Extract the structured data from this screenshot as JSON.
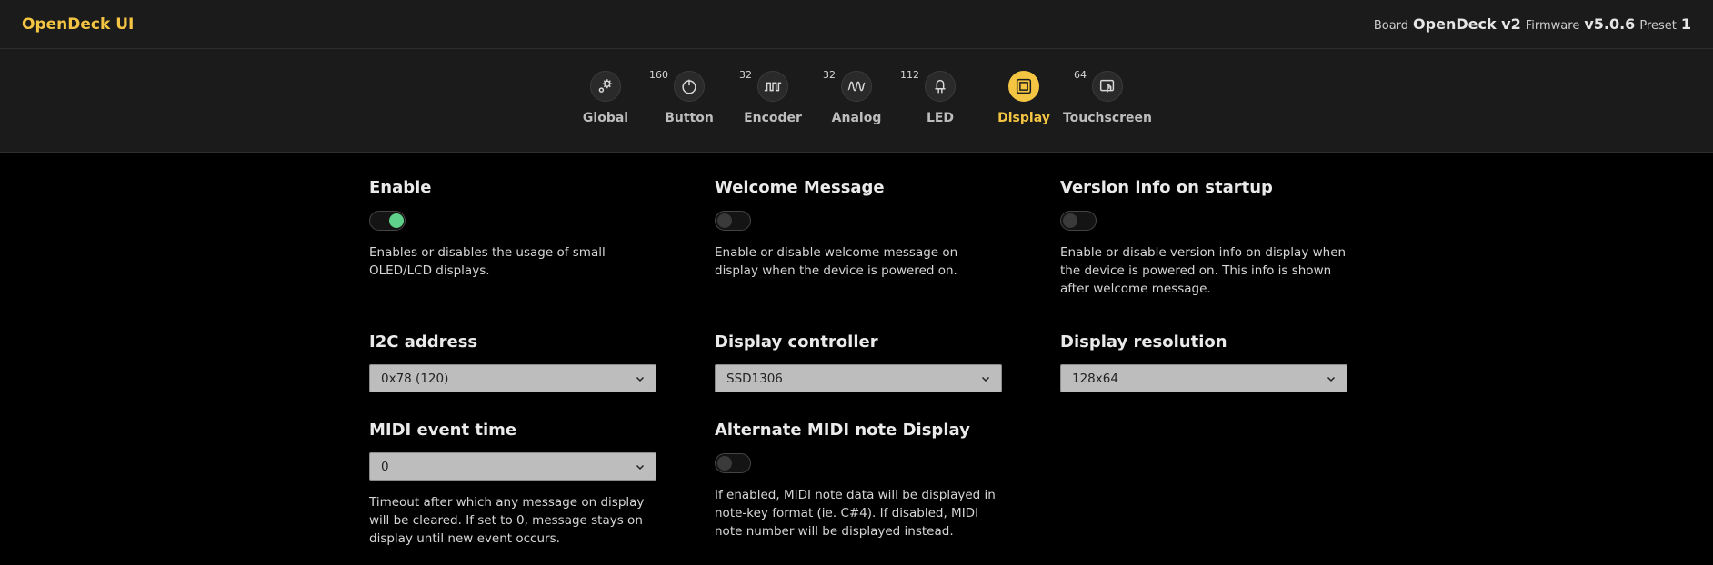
{
  "header": {
    "brand": "OpenDeck UI",
    "board_label": "Board",
    "board_value": "OpenDeck v2",
    "firmware_label": "Firmware",
    "firmware_value": "v5.0.6",
    "preset_label": "Preset",
    "preset_value": "1"
  },
  "nav": {
    "items": [
      {
        "label": "Global",
        "count": "",
        "icon": "gear-icon"
      },
      {
        "label": "Button",
        "count": "160",
        "icon": "power-button-icon"
      },
      {
        "label": "Encoder",
        "count": "32",
        "icon": "square-wave-icon"
      },
      {
        "label": "Analog",
        "count": "32",
        "icon": "sine-wave-icon"
      },
      {
        "label": "LED",
        "count": "112",
        "icon": "led-icon"
      },
      {
        "label": "Display",
        "count": "",
        "icon": "display-icon",
        "active": true
      },
      {
        "label": "Touchscreen",
        "count": "64",
        "icon": "touchscreen-icon"
      }
    ]
  },
  "settings": {
    "enable": {
      "title": "Enable",
      "on": true,
      "description": "Enables or disables the usage of small OLED/LCD displays."
    },
    "welcome": {
      "title": "Welcome Message",
      "on": false,
      "description": "Enable or disable welcome message on display when the device is powered on."
    },
    "version_info": {
      "title": "Version info on startup",
      "on": false,
      "description": "Enable or disable version info on display when the device is powered on. This info is shown after welcome message."
    },
    "i2c": {
      "title": "I2C address",
      "value": "0x78 (120)"
    },
    "controller": {
      "title": "Display controller",
      "value": "SSD1306"
    },
    "resolution": {
      "title": "Display resolution",
      "value": "128x64"
    },
    "midi_event_time": {
      "title": "MIDI event time",
      "value": "0",
      "description": "Timeout after which any message on display will be cleared. If set to 0, message stays on display until new event occurs."
    },
    "alt_midi_note": {
      "title": "Alternate MIDI note Display",
      "on": false,
      "description": "If enabled, MIDI note data will be displayed in note-key format (ie. C#4). If disabled, MIDI note number will be displayed instead."
    }
  },
  "colors": {
    "accent": "#f4c542",
    "toggle_on": "#5fd18a",
    "background": "#000000",
    "panel": "#1b1b1b"
  }
}
